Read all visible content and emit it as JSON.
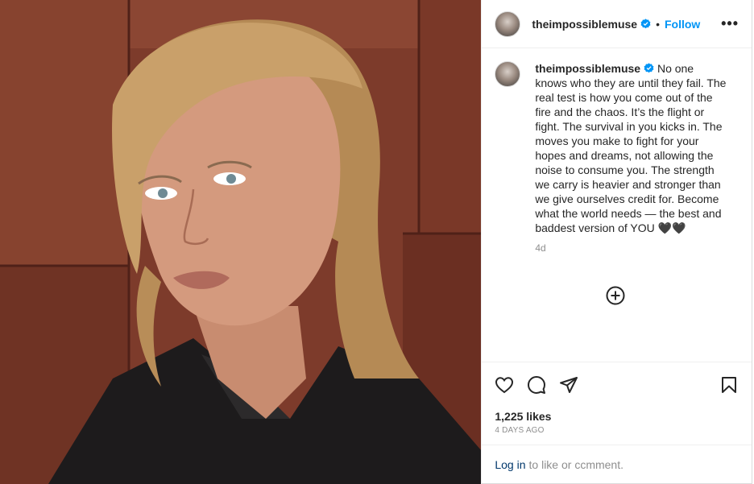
{
  "post": {
    "username": "theimpossiblemuse",
    "header_separator": "•",
    "follow_label": "Follow",
    "more_label": "•••",
    "caption": "No one knows who they are until they fail. The real test is how you come out of the fire and the chaos. It’s the flight or fight. The survival in you kicks in. The moves you make to fight for your hopes and dreams, not allowing the noise to consume you. The strength we carry is heavier and stronger than we give ourselves credit for. Become what the world needs — the best and baddest version of YOU 🖤🖤",
    "caption_age": "4d",
    "likes": "1,225 likes",
    "posted_ago": "4 DAYS AGO",
    "login_link": "Log in",
    "login_suffix": "to like or ccmment."
  },
  "colors": {
    "accent": "#0095f6",
    "link": "#00376b",
    "muted": "#8e8e8e",
    "text": "#262626"
  },
  "icons": [
    "verified-badge-icon",
    "more-options-icon",
    "add-comment-plus-icon",
    "heart-icon",
    "comment-icon",
    "share-icon",
    "bookmark-icon"
  ]
}
